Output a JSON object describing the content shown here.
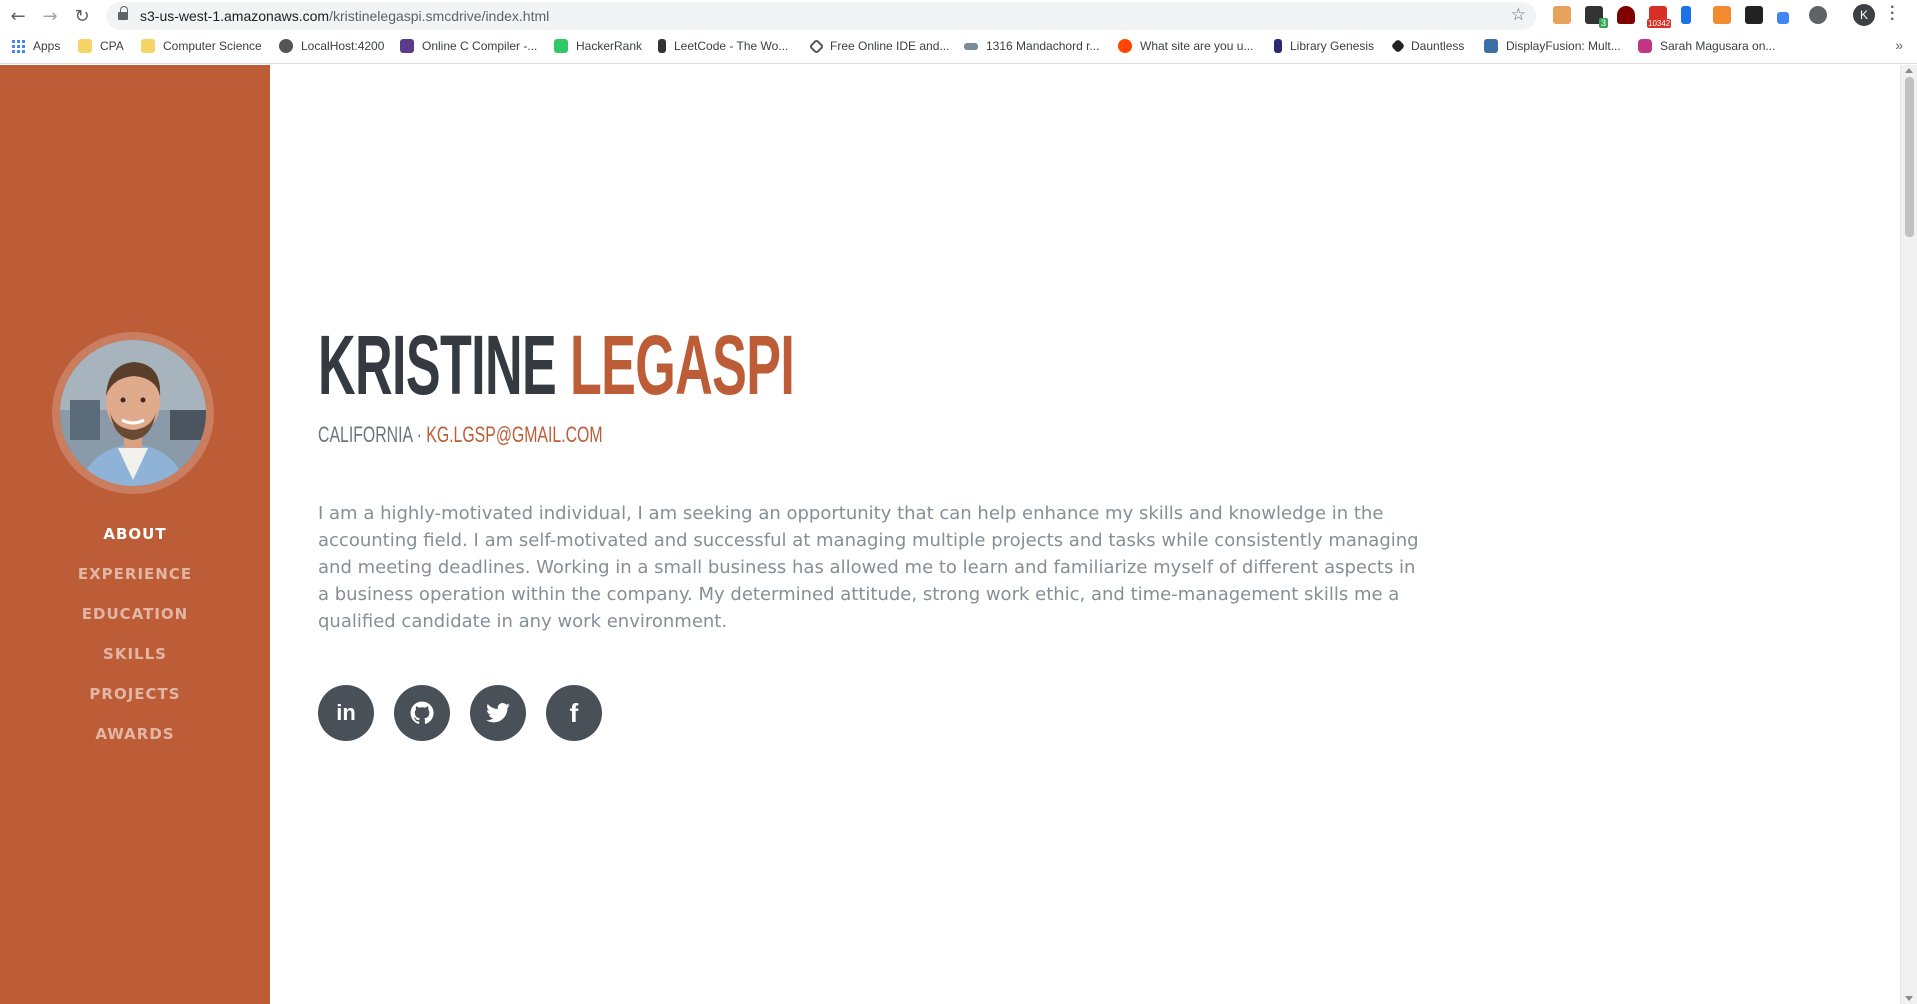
{
  "browser": {
    "url_host": "s3-us-west-1.amazonaws.com",
    "url_path": "/kristinelegaspi.smcdrive/index.html",
    "profile_initial": "K",
    "extension_badge_3": "3",
    "extension_badge_mail": "10342"
  },
  "bookmarks": [
    {
      "label": "Apps",
      "icon": "apps-grid-icon"
    },
    {
      "label": "CPA",
      "icon": "folder-icon"
    },
    {
      "label": "Computer Science",
      "icon": "folder-icon"
    },
    {
      "label": "LocalHost:4200",
      "icon": "localhost-icon"
    },
    {
      "label": "Online C Compiler -...",
      "icon": "compiler-icon"
    },
    {
      "label": "HackerRank",
      "icon": "hackerrank-icon"
    },
    {
      "label": "LeetCode - The Wo...",
      "icon": "leetcode-icon"
    },
    {
      "label": "Free Online IDE and...",
      "icon": "ide-icon"
    },
    {
      "label": "1316 Mandachord r...",
      "icon": "mandachord-icon"
    },
    {
      "label": "What site are you u...",
      "icon": "reddit-icon"
    },
    {
      "label": "Library Genesis",
      "icon": "library-icon"
    },
    {
      "label": "Dauntless",
      "icon": "dauntless-icon"
    },
    {
      "label": "DisplayFusion: Mult...",
      "icon": "displayfusion-icon"
    },
    {
      "label": "Sarah Magusara on...",
      "icon": "instagram-icon"
    }
  ],
  "sidebar": {
    "nav": [
      {
        "label": "ABOUT",
        "active": true
      },
      {
        "label": "EXPERIENCE",
        "active": false
      },
      {
        "label": "EDUCATION",
        "active": false
      },
      {
        "label": "SKILLS",
        "active": false
      },
      {
        "label": "PROJECTS",
        "active": false
      },
      {
        "label": "AWARDS",
        "active": false
      }
    ]
  },
  "about": {
    "first_name": "KRISTINE",
    "last_name": "LEGASPI",
    "location": "CALIFORNIA",
    "separator": " · ",
    "email": "KG.LGSP@GMAIL.COM",
    "bio": "I am a highly-motivated individual, I am seeking an opportunity that can help enhance my skills and knowledge in the accounting field. I am self-motivated and successful at managing multiple projects and tasks while consistently managing and meeting deadlines. Working in a small business has allowed me to learn and familiarize myself of different aspects in a business operation within the company. My determined attitude, strong work ethic, and time-management skills me a qualified candidate in any work environment.",
    "social": [
      {
        "name": "linkedin-icon",
        "glyph": "in"
      },
      {
        "name": "github-icon",
        "glyph": ""
      },
      {
        "name": "twitter-icon",
        "glyph": ""
      },
      {
        "name": "facebook-icon",
        "glyph": "f"
      }
    ]
  },
  "colors": {
    "primary": "#bd5d38",
    "dark": "#343a40",
    "muted": "#868e96",
    "social_bg": "#495057"
  }
}
